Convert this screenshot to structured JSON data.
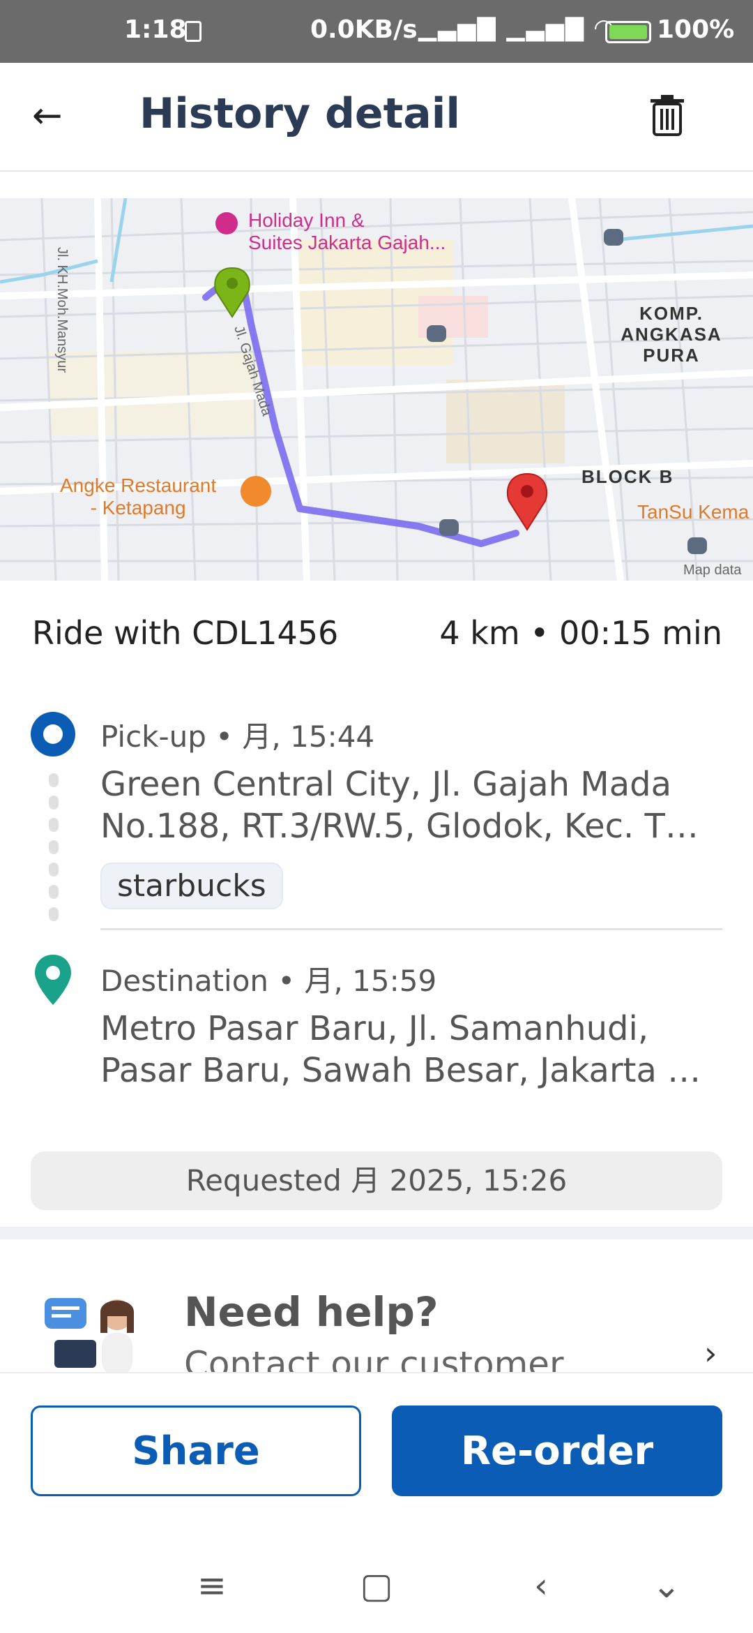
{
  "status_bar": {
    "time": "1:18",
    "network_speed": "0.0KB/s",
    "battery": "100%"
  },
  "header": {
    "title": "History detail"
  },
  "map": {
    "labels": {
      "hotel": "Holiday Inn &\nSuites Jakarta Gajah...",
      "street_gajah_mada": "Jl. Gajah Mada",
      "street_mansyur": "Jl. KH.Moh.Mansyur",
      "komp": "KOMP.\nANGKASA PURA",
      "block_b": "BLOCK B",
      "restaurant": "Angke Restaurant\n- Ketapang",
      "tansu": "TanSu Kema",
      "map_data": "Map data"
    },
    "colors": {
      "route": "#7b6cf0",
      "pickup_pin": "#7cb518",
      "destination_pin": "#e53935"
    }
  },
  "ride": {
    "label": "Ride with CDL1456",
    "stats": "4 km • 00:15 min"
  },
  "pickup": {
    "meta": "Pick-up •        月, 15:44",
    "address": "Green Central City, Jl. Gajah Mada No.188, RT.3/RW.5, Glodok, Kec. T…",
    "tag": "starbucks"
  },
  "destination": {
    "meta": "Destination •        月, 15:59",
    "address": "Metro Pasar Baru, Jl. Samanhudi, Pasar Baru, Sawah Besar, Jakarta …"
  },
  "requested": "Requested         月 2025, 15:26",
  "help": {
    "title": "Need help?",
    "subtitle": "Contact our customer"
  },
  "actions": {
    "share": "Share",
    "reorder": "Re-order"
  },
  "theme": {
    "primary": "#0b5cb5",
    "destination": "#1aa38a"
  }
}
